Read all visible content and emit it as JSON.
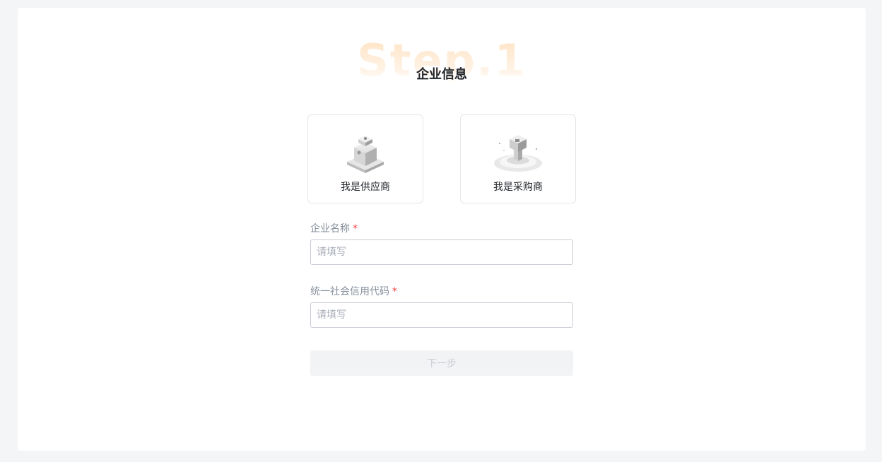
{
  "header": {
    "step_watermark": "Step.1",
    "title": "企业信息"
  },
  "roles": [
    {
      "label": "我是供应商",
      "icon": "supplier-illustration-icon"
    },
    {
      "label": "我是采购商",
      "icon": "buyer-illustration-icon"
    }
  ],
  "form": {
    "company_name": {
      "label": "企业名称",
      "required_mark": "*",
      "placeholder": "请填写",
      "value": ""
    },
    "credit_code": {
      "label": "统一社会信用代码",
      "required_mark": "*",
      "placeholder": "请填写",
      "value": ""
    },
    "next_button": "下一步"
  },
  "colors": {
    "page_bg": "#f4f5f7",
    "card_bg": "#ffffff",
    "watermark": "#ffe3c4",
    "required": "#f53f3f",
    "disabled_button_bg": "#f2f3f5",
    "disabled_button_text": "#c9cdd4"
  }
}
